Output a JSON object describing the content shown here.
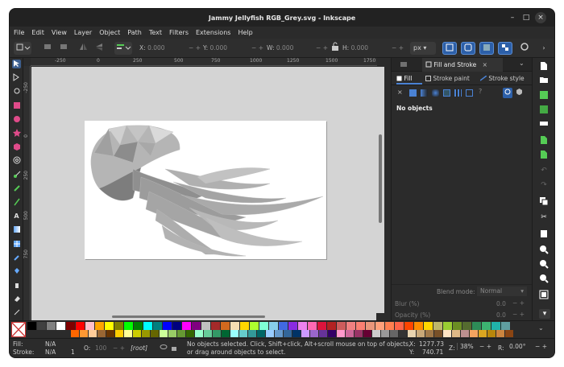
{
  "window": {
    "title": "Jammy Jellyfish RGB_Grey.svg - Inkscape",
    "minimize": "–",
    "maximize": "□",
    "close": "×"
  },
  "menu": [
    "File",
    "Edit",
    "View",
    "Layer",
    "Object",
    "Path",
    "Text",
    "Filters",
    "Extensions",
    "Help"
  ],
  "toolbar": {
    "x_label": "X:",
    "x_value": "0.000",
    "y_label": "Y:",
    "y_value": "0.000",
    "w_label": "W:",
    "w_value": "0.000",
    "h_label": "H:",
    "h_value": "0.000",
    "unit": "px",
    "minus": "−",
    "plus": "+"
  },
  "ruler": {
    "top": [
      "-250",
      "0",
      "250",
      "500",
      "750",
      "1000",
      "1250",
      "1500",
      "1750"
    ],
    "left": [
      "-250",
      "0",
      "250",
      "500",
      "750"
    ]
  },
  "dock": {
    "tab_title": "Fill and Stroke",
    "tab_close": "×",
    "subtabs": [
      "Fill",
      "Stroke paint",
      "Stroke style"
    ],
    "empty": "No objects",
    "blend_label": "Blend mode:",
    "blend_value": "Normal",
    "blur_label": "Blur (%)",
    "blur_value": "0.0",
    "opacity_label": "Opacity (%)",
    "opacity_value": "0.0"
  },
  "status": {
    "fill_label": "Fill:",
    "fill_value": "N/A",
    "stroke_label": "Stroke:",
    "stroke_value": "N/A",
    "stroke_width": "1",
    "o_label": "O:",
    "o_value": "100",
    "layer": "[root]",
    "message_line1": "No objects selected. Click, Shift+click, Alt+scroll mouse on top of objects,",
    "message_line2": "or drag around objects to select.",
    "x_label": "X:",
    "x_value": "1277.73",
    "y_label": "Y:",
    "y_value": "740.71",
    "z_label": "Z:",
    "zoom": "38%",
    "r_label": "R:",
    "rotation": "0.00°"
  },
  "colors": {
    "accent": "#2c5fa8",
    "palette_row1": [
      "#000000",
      "#404040",
      "#808080",
      "#ffffff",
      "#800000",
      "#ff0000",
      "#ffc0cb",
      "#ffa500",
      "#ffff00",
      "#808000",
      "#00ff00",
      "#008000",
      "#00ffff",
      "#008080",
      "#0000ff",
      "#000080",
      "#ff00ff",
      "#800080",
      "#c0c0c0",
      "#a52a2a",
      "#d2691e",
      "#f5deb3",
      "#ffd700",
      "#adff2f",
      "#7fffd4",
      "#87ceeb",
      "#4169e1",
      "#8a2be2",
      "#ee82ee",
      "#ff69b4",
      "#dc143c",
      "#b22222",
      "#cd5c5c",
      "#f08080",
      "#fa8072",
      "#e9967a",
      "#ffa07a",
      "#ff7f50",
      "#ff6347",
      "#ff4500",
      "#ff8c00",
      "#ffd700",
      "#bdb76b",
      "#9acd32",
      "#6b8e23",
      "#556b2f",
      "#2e8b57",
      "#3cb371",
      "#20b2aa",
      "#5f9ea0"
    ],
    "palette_row2": [
      "#ff6600",
      "#ff9933",
      "#ffcc99",
      "#996633",
      "#663300",
      "#ffcc00",
      "#ffff99",
      "#cccc00",
      "#999900",
      "#666600",
      "#ccff99",
      "#99cc66",
      "#669933",
      "#336600",
      "#99ffcc",
      "#66cc99",
      "#339966",
      "#006633",
      "#99ffff",
      "#66cccc",
      "#339999",
      "#006666",
      "#99ccff",
      "#6699cc",
      "#336699",
      "#003366",
      "#cc99ff",
      "#9966cc",
      "#663399",
      "#330066",
      "#ff99cc",
      "#cc6699",
      "#993366",
      "#660033",
      "#cccccc",
      "#999999",
      "#666666",
      "#333333",
      "#e8d4b0",
      "#c8a878",
      "#a07848",
      "#785028",
      "#ffe4c4",
      "#deb887",
      "#bc8f8f",
      "#f4a460",
      "#daa520",
      "#b8860b",
      "#cd853f",
      "#8b4513"
    ]
  }
}
